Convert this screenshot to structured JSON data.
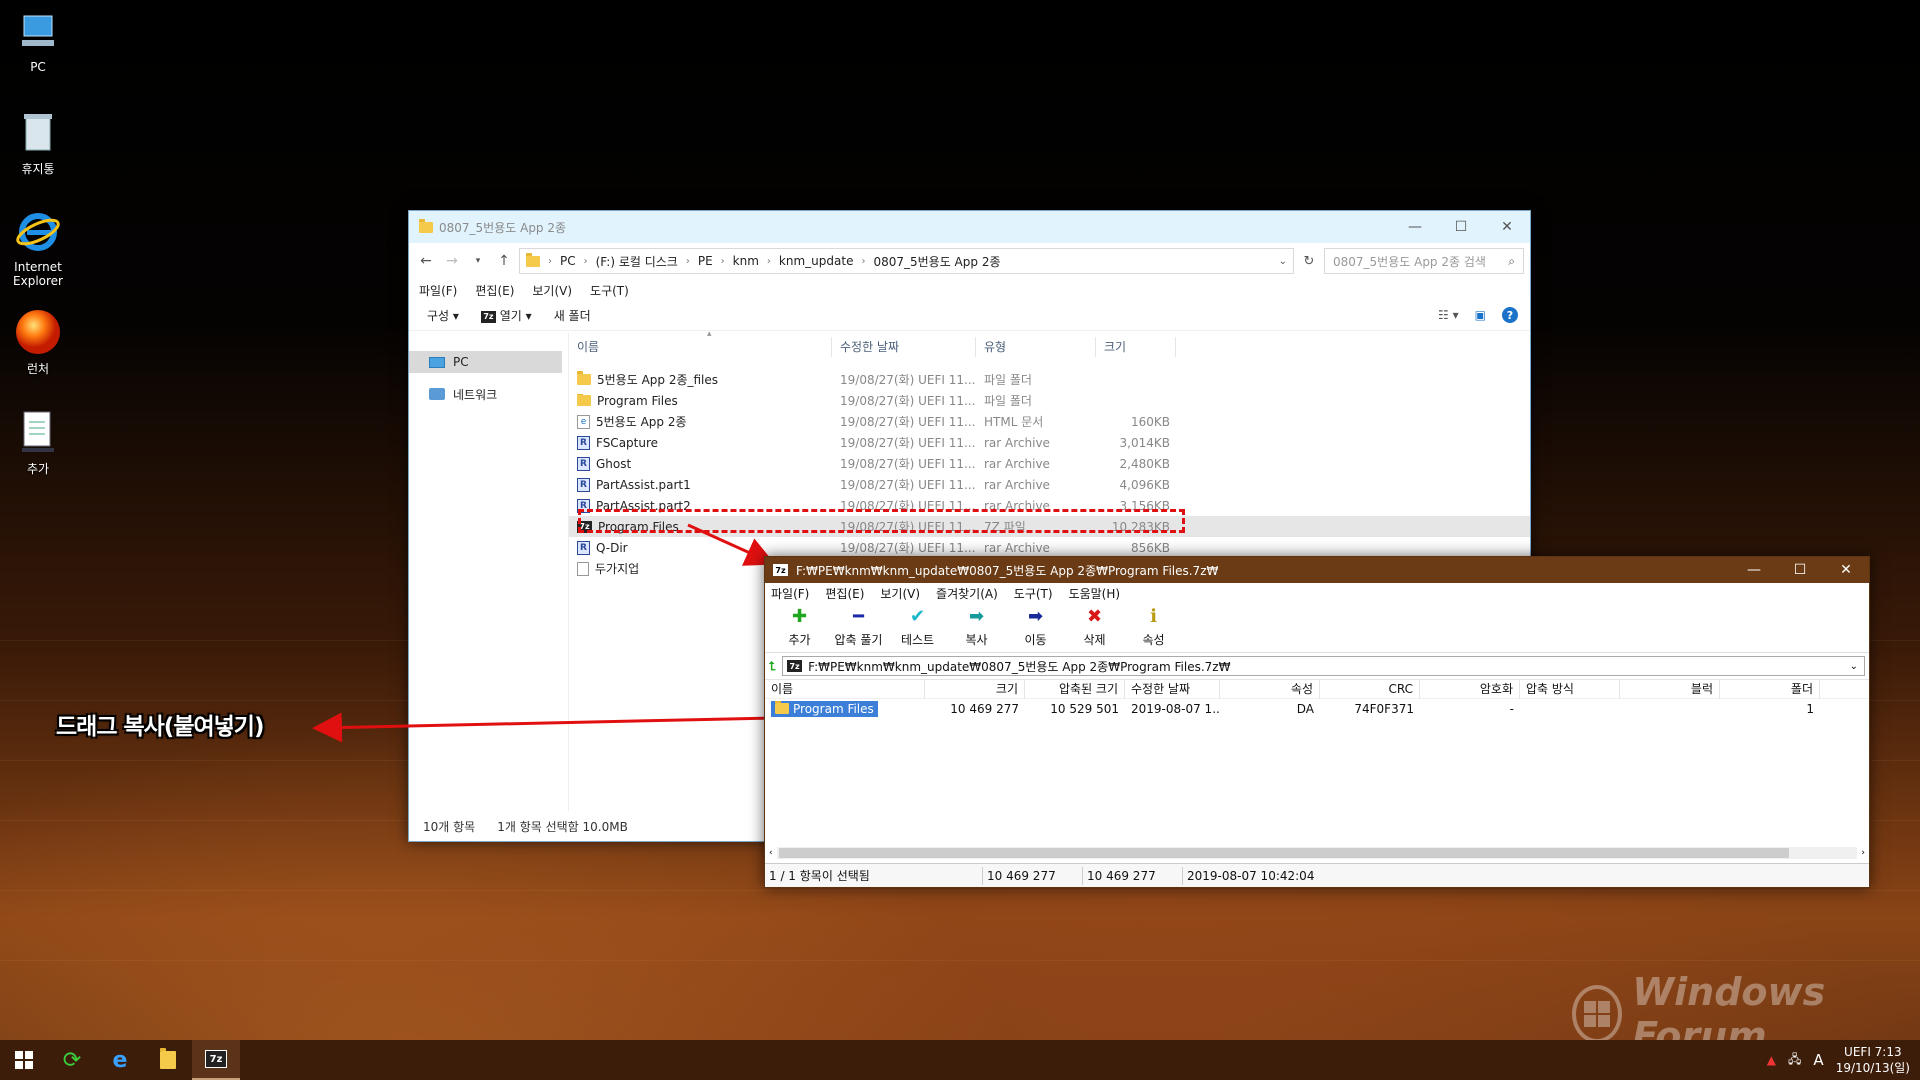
{
  "desktop": {
    "icons": [
      {
        "label": "PC",
        "icon": "pc-icon"
      },
      {
        "label": "휴지통",
        "icon": "recycle-bin-icon"
      },
      {
        "label": "Internet Explorer",
        "icon": "internet-explorer-icon"
      },
      {
        "label": "런처",
        "icon": "launcher-icon"
      },
      {
        "label": "추가",
        "icon": "add-icon"
      }
    ]
  },
  "explorer": {
    "title": "0807_5번용도 App 2종",
    "breadcrumb": [
      "PC",
      "(F:) 로컬 디스크",
      "PE",
      "knm",
      "knm_update",
      "0807_5번용도 App 2종"
    ],
    "search_placeholder": "0807_5번용도 App 2종 검색",
    "menu": [
      "파일(F)",
      "편집(E)",
      "보기(V)",
      "도구(T)"
    ],
    "commands": {
      "organize": "구성",
      "open": "열기",
      "new_folder": "새 폴더"
    },
    "nav": [
      "PC",
      "네트워크"
    ],
    "columns": {
      "name": "이름",
      "date": "수정한 날짜",
      "type": "유형",
      "size": "크기"
    },
    "files": [
      {
        "name": "5번용도 App 2종_files",
        "date": "19/08/27(화) UEFI  11...",
        "type": "파일 폴더",
        "size": "",
        "kind": "folder"
      },
      {
        "name": "Program Files",
        "date": "19/08/27(화) UEFI  11...",
        "type": "파일 폴더",
        "size": "",
        "kind": "folder"
      },
      {
        "name": "5번용도 App 2종",
        "date": "19/08/27(화) UEFI  11...",
        "type": "HTML 문서",
        "size": "160KB",
        "kind": "html"
      },
      {
        "name": "FSCapture",
        "date": "19/08/27(화) UEFI  11...",
        "type": "rar Archive",
        "size": "3,014KB",
        "kind": "rar"
      },
      {
        "name": "Ghost",
        "date": "19/08/27(화) UEFI  11...",
        "type": "rar Archive",
        "size": "2,480KB",
        "kind": "rar"
      },
      {
        "name": "PartAssist.part1",
        "date": "19/08/27(화) UEFI  11...",
        "type": "rar Archive",
        "size": "4,096KB",
        "kind": "rar"
      },
      {
        "name": "PartAssist.part2",
        "date": "19/08/27(화) UEFI  11...",
        "type": "rar Archive",
        "size": "3,156KB",
        "kind": "rar"
      },
      {
        "name": "Program Files",
        "date": "19/08/27(화) UEFI  11...",
        "type": "7Z 파일",
        "size": "10,283KB",
        "kind": "7z",
        "selected": true
      },
      {
        "name": "Q-Dir",
        "date": "19/08/27(화) UEFI  11...",
        "type": "rar Archive",
        "size": "856KB",
        "kind": "rar"
      },
      {
        "name": "두가지업",
        "date": "",
        "type": "",
        "size": "",
        "kind": "doc"
      }
    ],
    "status": {
      "count": "10개 항목",
      "selection": "1개 항목 선택함 10.0MB"
    }
  },
  "zip": {
    "title": "F:₩PE₩knm₩knm_update₩0807_5번용도 App 2종₩Program Files.7z₩",
    "menu": [
      "파일(F)",
      "편집(E)",
      "보기(V)",
      "즐겨찾기(A)",
      "도구(T)",
      "도움말(H)"
    ],
    "tools": [
      {
        "label": "추가",
        "glyph": "✚",
        "color": "#1fa81f"
      },
      {
        "label": "압축 풀기",
        "glyph": "━",
        "color": "#1a2aa8"
      },
      {
        "label": "테스트",
        "glyph": "✔",
        "color": "#18b8c8"
      },
      {
        "label": "복사",
        "glyph": "➡",
        "color": "#179a9a"
      },
      {
        "label": "이동",
        "glyph": "➡",
        "color": "#1a2a98"
      },
      {
        "label": "삭제",
        "glyph": "✖",
        "color": "#d81818"
      },
      {
        "label": "속성",
        "glyph": "ℹ",
        "color": "#b89a10"
      }
    ],
    "path": "F:₩PE₩knm₩knm_update₩0807_5번용도 App 2종₩Program Files.7z₩",
    "columns": {
      "name": "이름",
      "size": "크기",
      "packed": "압축된 크기",
      "modified": "수정한 날짜",
      "attr": "속성",
      "crc": "CRC",
      "encrypted": "암호화",
      "method": "압축 방식",
      "block": "블럭",
      "folders": "폴더"
    },
    "rows": [
      {
        "name": "Program Files",
        "size": "10 469 277",
        "packed": "10 529 501",
        "modified": "2019-08-07 1...",
        "attr": "DA",
        "crc": "74F0F371",
        "encrypted": "-",
        "method": "",
        "block": "",
        "folders": "1"
      }
    ],
    "status": {
      "selection": "1 / 1 항목이 선택됨",
      "size": "10 469 277",
      "packed": "10 469 277",
      "modified": "2019-08-07 10:42:04"
    }
  },
  "annotation": {
    "text": "드래그 복사(붙여넣기)"
  },
  "taskbar": {
    "items": [
      "start-icon",
      "refresh-icon",
      "internet-explorer-icon",
      "file-explorer-icon",
      "7zip-icon"
    ],
    "tray": {
      "ime": "A",
      "clock_line1": "UEFI  7:13",
      "clock_line2": "19/10/13(일)"
    }
  },
  "watermark": {
    "text": "Windows Forum"
  }
}
